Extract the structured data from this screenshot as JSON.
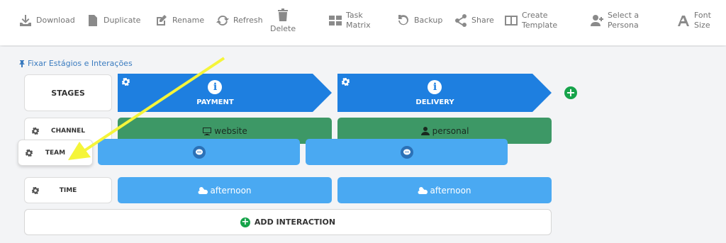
{
  "toolbar": {
    "download": "Download",
    "duplicate": "Duplicate",
    "rename": "Rename",
    "refresh": "Refresh",
    "delete": "Delete",
    "task_matrix_1": "Task",
    "task_matrix_2": "Matrix",
    "backup": "Backup",
    "share": "Share",
    "create_template_1": "Create",
    "create_template_2": "Template",
    "select_persona_1": "Select a",
    "select_persona_2": "Persona",
    "font_size_1": "Font",
    "font_size_2": "Size"
  },
  "pin_label": "Fixar Estágios e Interações",
  "rows": {
    "stages": "STAGES",
    "channel": "CHANNEL",
    "team": "TEAM",
    "time": "TIME"
  },
  "stages": [
    {
      "name": "PAYMENT"
    },
    {
      "name": "DELIVERY"
    }
  ],
  "channel_cells": [
    "website",
    "personal"
  ],
  "time_cells": [
    "afternoon",
    "afternoon"
  ],
  "add_interaction": "ADD INTERACTION",
  "colors": {
    "stage_blue": "#1e7fe0",
    "channel_green": "#3d9866",
    "light_blue": "#4aa9f2",
    "add_green": "#16a34a",
    "annotation_arrow": "#f5f53a"
  }
}
